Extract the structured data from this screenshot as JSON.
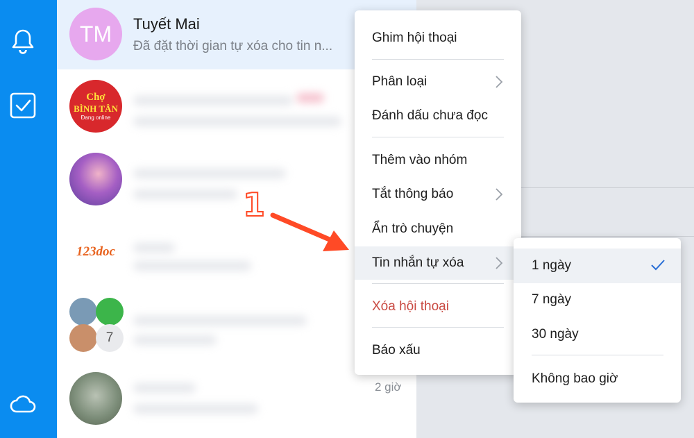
{
  "rail": {
    "icons": [
      "bell-icon",
      "checkbox-icon",
      "cloud-icon"
    ],
    "color": "#0a8cf0"
  },
  "conversation": {
    "avatar_initials": "TM",
    "name": "Tuyết Mai",
    "preview": "Đã đặt thời gian tự xóa cho tin n..."
  },
  "avatars": {
    "cho_line1": "Chợ",
    "cho_line2": "BÌNH TÂN",
    "cho_line3": "Đang online",
    "doc_logo": "123doc",
    "group_count": "7"
  },
  "last_time": "2 giờ",
  "context_menu": {
    "items": [
      {
        "label": "Ghim hội thoại"
      },
      {
        "label": "Phân loại"
      },
      {
        "label": "Đánh dấu chưa đọc"
      },
      {
        "label": "Thêm vào nhóm"
      },
      {
        "label": "Tắt thông báo"
      },
      {
        "label": "Ẩn trò chuyện"
      },
      {
        "label": "Tin nhắn tự xóa"
      },
      {
        "label": "Xóa hội thoại"
      },
      {
        "label": "Báo xấu"
      }
    ]
  },
  "submenu": {
    "items": [
      {
        "label": "1 ngày",
        "selected": true
      },
      {
        "label": "7 ngày"
      },
      {
        "label": "30 ngày"
      },
      {
        "label": "Không bao giờ"
      }
    ]
  },
  "annotation": {
    "step": "1",
    "color": "#ff4a26"
  }
}
